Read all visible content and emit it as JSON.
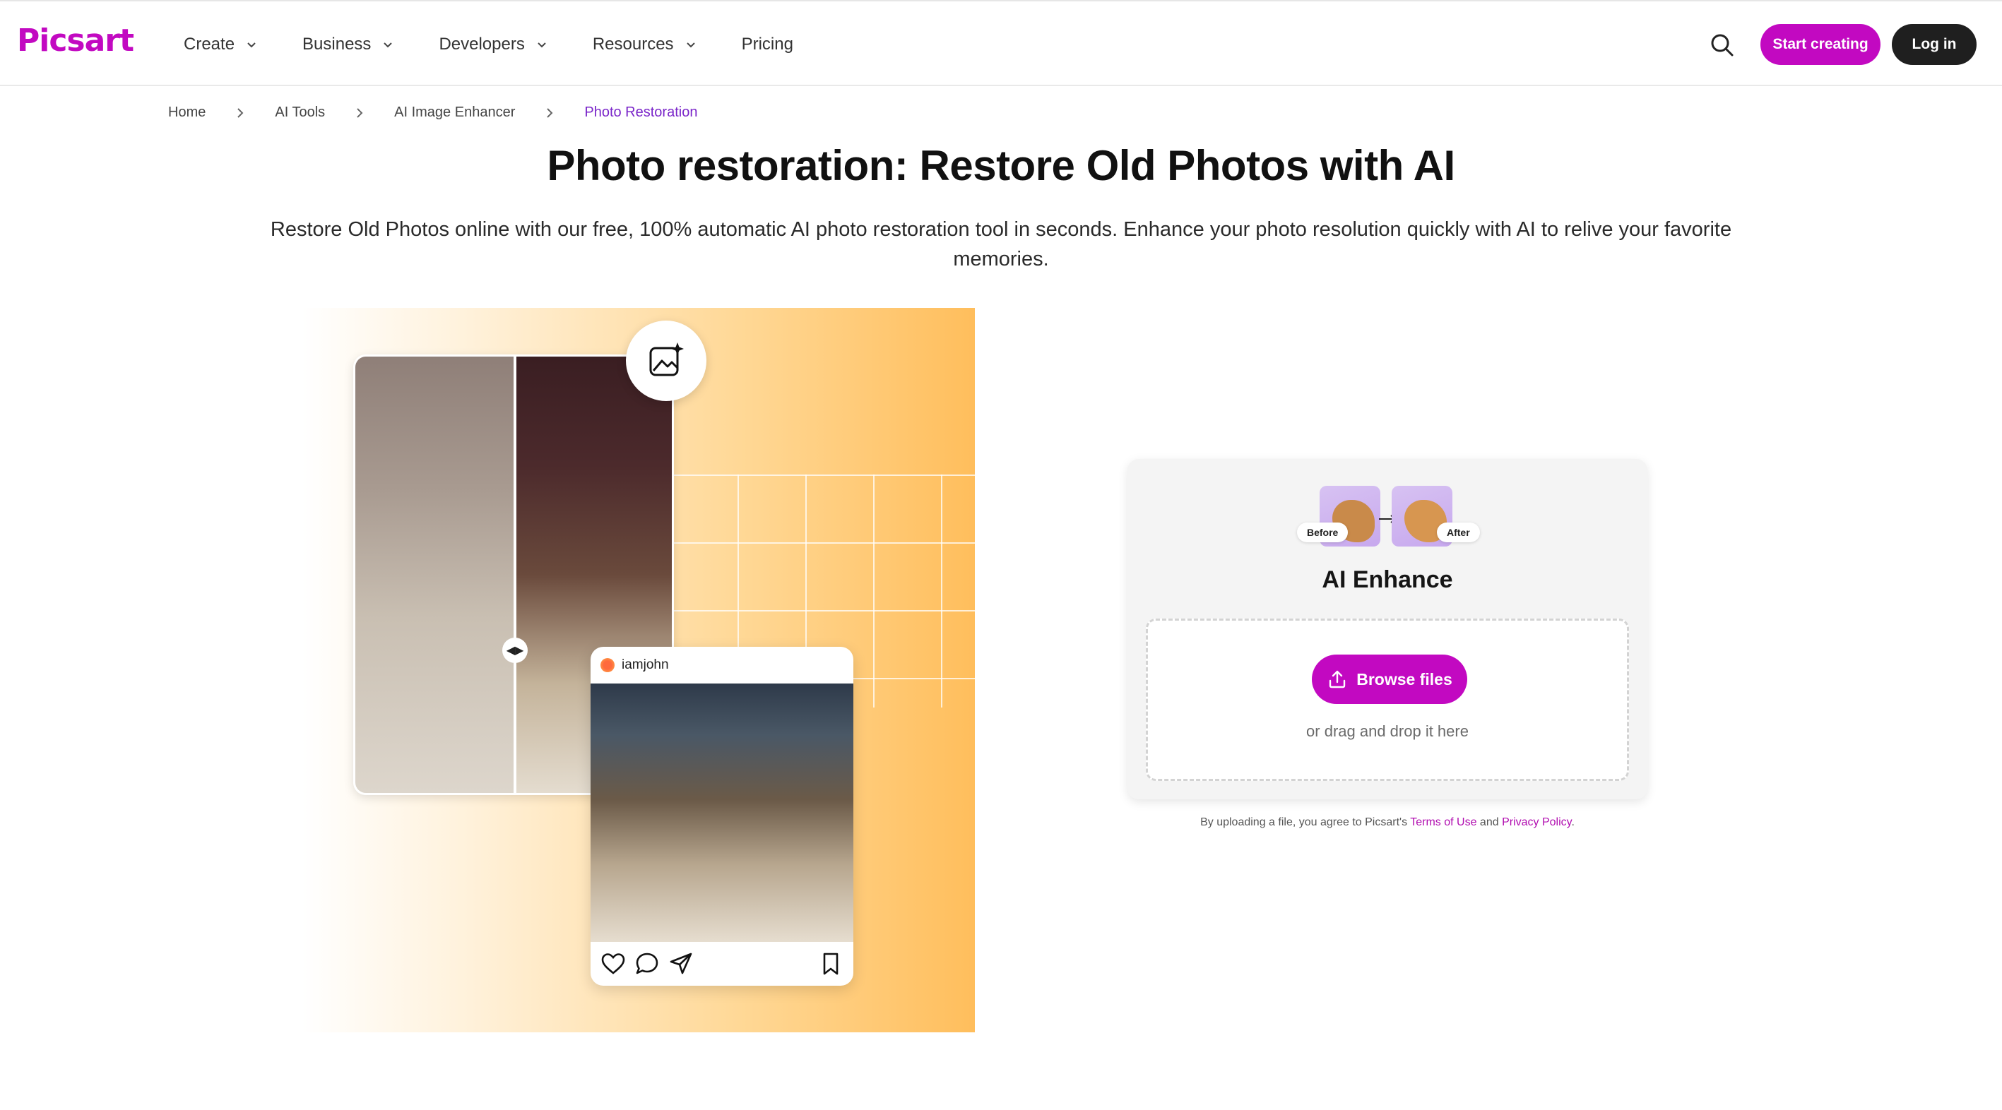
{
  "brand": {
    "logo_text": "Picsart",
    "accent": "#c209c1",
    "dark": "#1f1f1f"
  },
  "nav": {
    "items": [
      {
        "label": "Create",
        "has_dropdown": true
      },
      {
        "label": "Business",
        "has_dropdown": true
      },
      {
        "label": "Developers",
        "has_dropdown": true
      },
      {
        "label": "Resources",
        "has_dropdown": true
      },
      {
        "label": "Pricing",
        "has_dropdown": false
      }
    ],
    "start_label": "Start creating",
    "login_label": "Log in"
  },
  "breadcrumb": [
    "Home",
    "AI Tools",
    "AI Image Enhancer",
    "Photo Restoration"
  ],
  "hero": {
    "title": "Photo restoration: Restore Old Photos with AI",
    "subtitle": "Restore Old Photos online with our free, 100% automatic AI photo restoration tool in seconds. Enhance your photo resolution quickly with AI to relive your favorite memories."
  },
  "illustration": {
    "post_username": "iamjohn",
    "icons": [
      "image-sparkle-icon",
      "compare-handle-icon",
      "heart-icon",
      "comment-icon",
      "send-icon",
      "bookmark-icon"
    ]
  },
  "upload": {
    "before_label": "Before",
    "after_label": "After",
    "title": "AI Enhance",
    "browse_label": "Browse files",
    "drop_hint": "or drag and drop it here",
    "terms_prefix": "By uploading a file, you agree to Picsart's ",
    "terms_link": "Terms of Use",
    "terms_mid": " and ",
    "privacy_link": "Privacy Policy",
    "terms_suffix": "."
  }
}
